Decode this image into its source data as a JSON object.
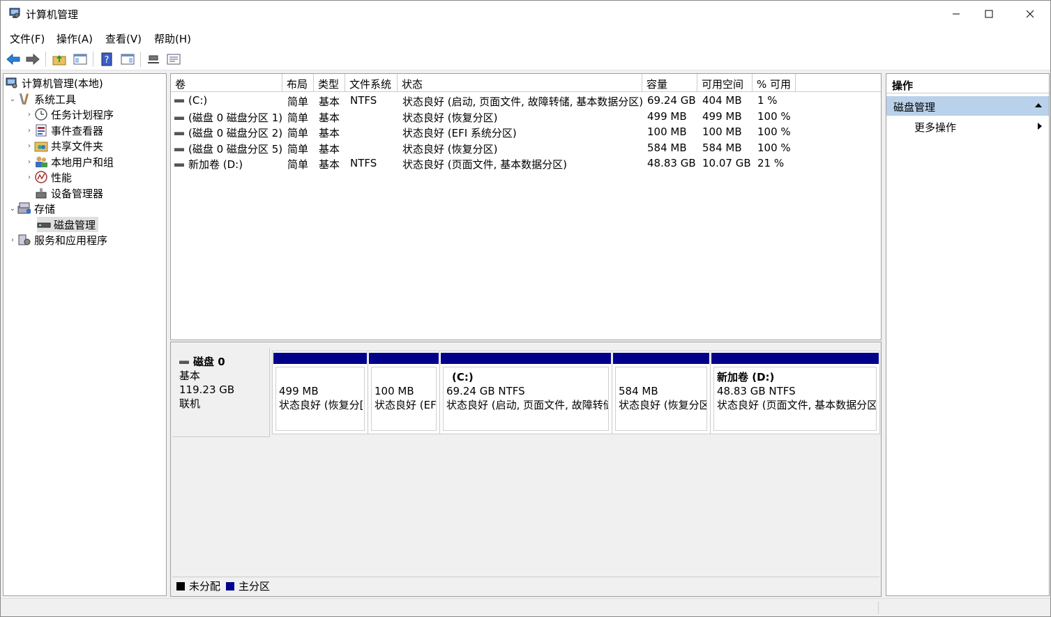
{
  "window": {
    "title": "计算机管理"
  },
  "menu": [
    "文件(F)",
    "操作(A)",
    "查看(V)",
    "帮助(H)"
  ],
  "tree": {
    "root": "计算机管理(本地)",
    "system_tools": "系统工具",
    "task_scheduler": "任务计划程序",
    "event_viewer": "事件查看器",
    "shared_folders": "共享文件夹",
    "local_users": "本地用户和组",
    "performance": "性能",
    "device_manager": "设备管理器",
    "storage": "存储",
    "disk_management": "磁盘管理",
    "services_apps": "服务和应用程序"
  },
  "columns": [
    "卷",
    "布局",
    "类型",
    "文件系统",
    "状态",
    "容量",
    "可用空间",
    "% 可用"
  ],
  "volumes": [
    [
      "(C:)",
      "简单",
      "基本",
      "NTFS",
      "状态良好 (启动, 页面文件, 故障转储, 基本数据分区)",
      "69.24 GB",
      "404 MB",
      "1 %"
    ],
    [
      "(磁盘 0 磁盘分区 1)",
      "简单",
      "基本",
      "",
      "状态良好 (恢复分区)",
      "499 MB",
      "499 MB",
      "100 %"
    ],
    [
      "(磁盘 0 磁盘分区 2)",
      "简单",
      "基本",
      "",
      "状态良好 (EFI 系统分区)",
      "100 MB",
      "100 MB",
      "100 %"
    ],
    [
      "(磁盘 0 磁盘分区 5)",
      "简单",
      "基本",
      "",
      "状态良好 (恢复分区)",
      "584 MB",
      "584 MB",
      "100 %"
    ],
    [
      "新加卷 (D:)",
      "简单",
      "基本",
      "NTFS",
      "状态良好 (页面文件, 基本数据分区)",
      "48.83 GB",
      "10.07 GB",
      "21 %"
    ]
  ],
  "disk": {
    "name": "磁盘 0",
    "type": "基本",
    "size": "119.23 GB",
    "status": "联机"
  },
  "partitions": [
    {
      "name": "",
      "size": "499 MB",
      "status": "状态良好 (恢复分["
    },
    {
      "name": "",
      "size": "100 MB",
      "status": "状态良好 (EF"
    },
    {
      "name": "(C:)",
      "size": "69.24 GB NTFS",
      "status": "状态良好 (启动, 页面文件, 故障转储"
    },
    {
      "name": "",
      "size": "584 MB",
      "status": "状态良好 (恢复分区"
    },
    {
      "name": "新加卷 (D:)",
      "size": "48.83 GB NTFS",
      "status": "状态良好 (页面文件, 基本数据分区"
    }
  ],
  "legend": {
    "unallocated": "未分配",
    "primary": "主分区"
  },
  "colors": {
    "primary_partition": "#00008b",
    "unallocated": "#000000",
    "selected_action": "#b9d1ea"
  },
  "actions": {
    "header": "操作",
    "section": "磁盘管理",
    "more": "更多操作"
  }
}
